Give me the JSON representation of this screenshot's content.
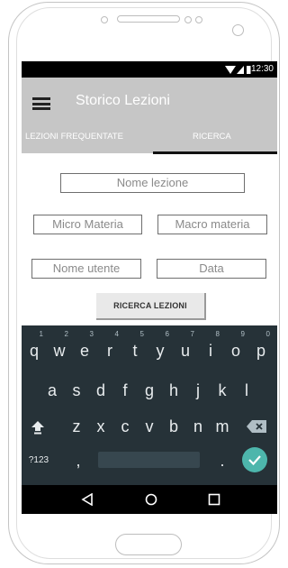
{
  "status_bar": {
    "time": "12:30"
  },
  "app_bar": {
    "title": "Storico Lezioni"
  },
  "tabs": [
    {
      "label": "LEZIONI FREQUENTATE"
    },
    {
      "label": "RICERCA"
    }
  ],
  "form": {
    "nome_lezione": "Nome lezione",
    "micro_materia": "Micro Materia",
    "macro_materia": "Macro materia",
    "nome_utente": "Nome utente",
    "data": "Data"
  },
  "search_button": "RICERCA LEZIONI",
  "keyboard": {
    "row1": [
      {
        "k": "q",
        "s": "1"
      },
      {
        "k": "w",
        "s": "2"
      },
      {
        "k": "e",
        "s": "3"
      },
      {
        "k": "r",
        "s": "4"
      },
      {
        "k": "t",
        "s": "5"
      },
      {
        "k": "y",
        "s": "6"
      },
      {
        "k": "u",
        "s": "7"
      },
      {
        "k": "i",
        "s": "8"
      },
      {
        "k": "o",
        "s": "9"
      },
      {
        "k": "p",
        "s": "0"
      }
    ],
    "row2": [
      "a",
      "s",
      "d",
      "f",
      "g",
      "h",
      "j",
      "k",
      "l"
    ],
    "row3": [
      "z",
      "x",
      "c",
      "v",
      "b",
      "n",
      "m"
    ],
    "symbols_key": "?123",
    "comma_key": ",",
    "period_key": "."
  },
  "icons": {
    "menu": "hamburger-menu-icon",
    "shift": "shift-icon",
    "backspace": "backspace-icon",
    "enter": "checkmark-icon",
    "back": "back-triangle-icon",
    "home": "home-circle-icon",
    "recents": "recents-square-icon"
  },
  "colors": {
    "app_bar": "#c6c6c6",
    "keyboard": "#263238",
    "enter_key": "#4db6ac",
    "status_bar": "#000000"
  }
}
